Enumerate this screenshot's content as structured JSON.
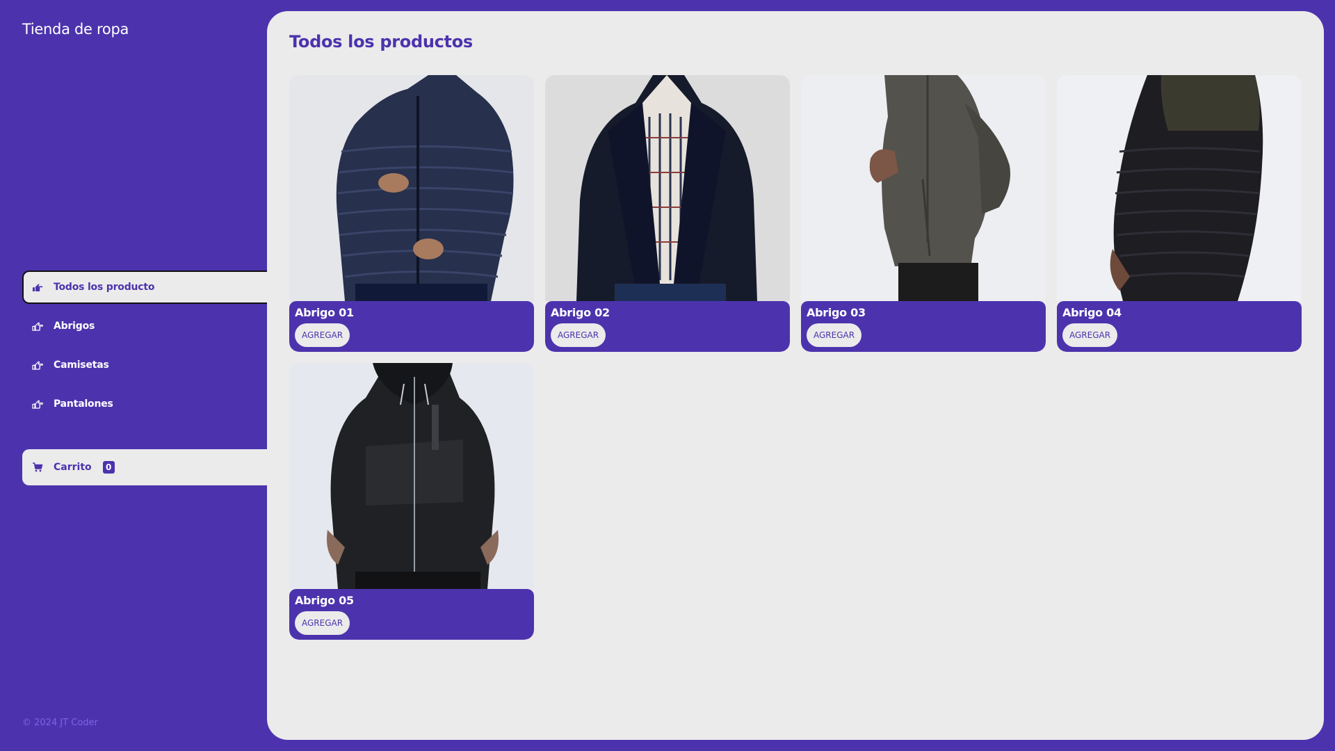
{
  "app": {
    "brand": "Tienda de ropa",
    "footer": "© 2024 JT Coder"
  },
  "sidebar": {
    "items": [
      {
        "label": "Todos los producto",
        "icon": "hand-pointing-icon",
        "active": true
      },
      {
        "label": "Abrigos",
        "icon": "hand-pointing-icon",
        "active": false
      },
      {
        "label": "Camisetas",
        "icon": "hand-pointing-icon",
        "active": false
      },
      {
        "label": "Pantalones",
        "icon": "hand-pointing-icon",
        "active": false
      }
    ],
    "cart": {
      "label": "Carrito",
      "count": "0",
      "icon": "cart-icon"
    }
  },
  "main": {
    "title": "Todos los productos",
    "products": [
      {
        "name": "Abrigo 01",
        "button": "AGREGAR",
        "image": "navy puffer jacket"
      },
      {
        "name": "Abrigo 02",
        "button": "AGREGAR",
        "image": "black jacket over plaid shirt"
      },
      {
        "name": "Abrigo 03",
        "button": "AGREGAR",
        "image": "grey zip jacket"
      },
      {
        "name": "Abrigo 04",
        "button": "AGREGAR",
        "image": "dark puffer jacket side view"
      },
      {
        "name": "Abrigo 05",
        "button": "AGREGAR",
        "image": "black hooded zip jacket"
      }
    ]
  },
  "colors": {
    "accent": "#4c33ad",
    "panel": "#ebebeb",
    "footer_text": "#7e62e6"
  }
}
